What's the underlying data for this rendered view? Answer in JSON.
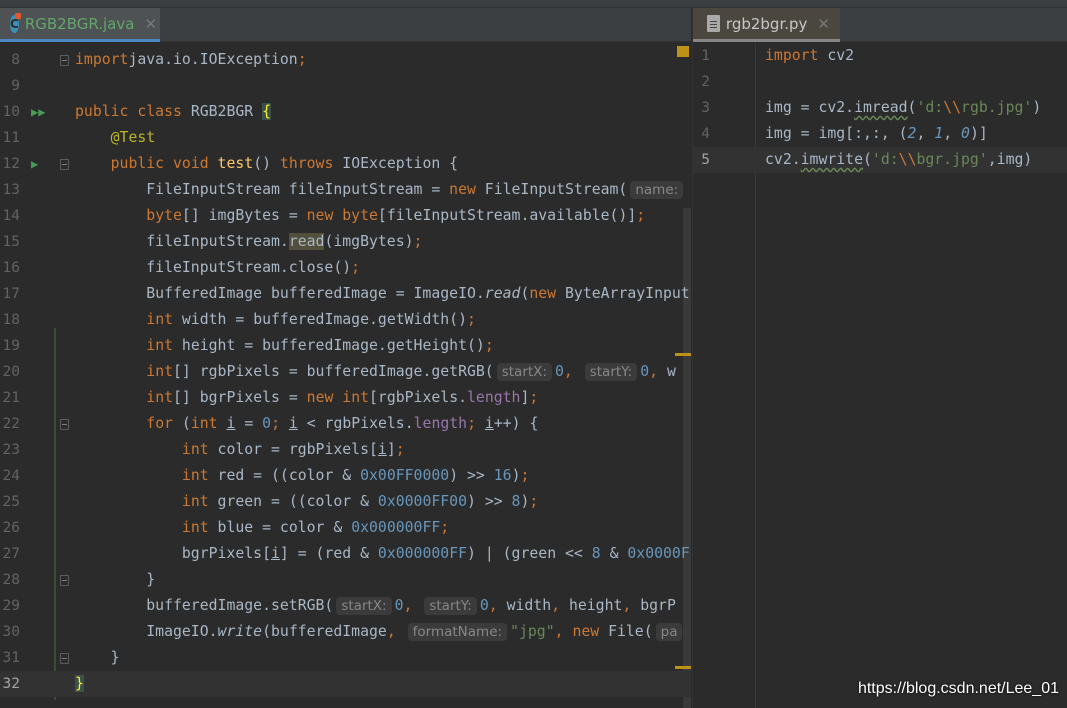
{
  "tabs": [
    {
      "label": "RGB2BGR.java",
      "icon": "java-class-icon",
      "close_glyph": "✕",
      "active": true
    },
    {
      "label": "rgb2bgr.py",
      "icon": "python-file-icon",
      "close_glyph": "✕",
      "active": true
    }
  ],
  "colors": {
    "keyword": "#cc7832",
    "number": "#6897bb",
    "string": "#6a8759",
    "field": "#9876aa",
    "annotation": "#bbb529",
    "method_decl": "#ffc66d",
    "text": "#a9b7c6",
    "background": "#2b2b2b"
  },
  "java": {
    "current_line": "32",
    "lines": [
      {
        "n": "8",
        "fold": true,
        "t": [
          [
            "kw",
            "import"
          ],
          [
            "",
            "java.io.IOException"
          ],
          [
            "kw",
            ";"
          ]
        ]
      },
      {
        "n": "9",
        "t": []
      },
      {
        "n": "10",
        "run": "▶▶",
        "t": [
          [
            "kw",
            "public class "
          ],
          [
            "",
            "RGB2BGR "
          ],
          [
            "brace",
            "{"
          ]
        ]
      },
      {
        "n": "11",
        "t": [
          [
            "",
            "    "
          ],
          [
            "ann",
            "@Test"
          ]
        ]
      },
      {
        "n": "12",
        "run": "▶",
        "fold": true,
        "t": [
          [
            "",
            "    "
          ],
          [
            "kw",
            "public void "
          ],
          [
            "fn",
            "test"
          ],
          [
            "",
            "() "
          ],
          [
            "kw",
            "throws "
          ],
          [
            "",
            "IOException {"
          ]
        ]
      },
      {
        "n": "13",
        "t": [
          [
            "",
            "        FileInputStream fileInputStream = "
          ],
          [
            "kw",
            "new "
          ],
          [
            "",
            "FileInputStream("
          ],
          [
            "hint",
            "name:"
          ]
        ]
      },
      {
        "n": "14",
        "t": [
          [
            "",
            "        "
          ],
          [
            "kw",
            "byte"
          ],
          [
            "",
            "[] imgBytes = "
          ],
          [
            "kw",
            "new byte"
          ],
          [
            "",
            "[fileInputStream.available()]"
          ],
          [
            "kw",
            ";"
          ]
        ]
      },
      {
        "n": "15",
        "t": [
          [
            "",
            "        fileInputStream."
          ],
          [
            "hl",
            "read"
          ],
          [
            "",
            "(imgBytes)"
          ],
          [
            "kw",
            ";"
          ]
        ]
      },
      {
        "n": "16",
        "t": [
          [
            "",
            "        fileInputStream.close()"
          ],
          [
            "kw",
            ";"
          ]
        ]
      },
      {
        "n": "17",
        "t": [
          [
            "",
            "        BufferedImage bufferedImage = ImageIO."
          ],
          [
            "it",
            "read"
          ],
          [
            "",
            "("
          ],
          [
            "kw",
            "new "
          ],
          [
            "",
            "ByteArrayInput"
          ]
        ]
      },
      {
        "n": "18",
        "t": [
          [
            "",
            "        "
          ],
          [
            "kw",
            "int "
          ],
          [
            "",
            "width = bufferedImage.getWidth()"
          ],
          [
            "kw",
            ";"
          ]
        ]
      },
      {
        "n": "19",
        "t": [
          [
            "",
            "        "
          ],
          [
            "kw",
            "int "
          ],
          [
            "",
            "height = bufferedImage.getHeight()"
          ],
          [
            "kw",
            ";"
          ]
        ]
      },
      {
        "n": "20",
        "t": [
          [
            "",
            "        "
          ],
          [
            "kw",
            "int"
          ],
          [
            "",
            "[] rgbPixels = bufferedImage.getRGB("
          ],
          [
            "hint",
            "startX:"
          ],
          [
            "num",
            "0"
          ],
          [
            "kw",
            ", "
          ],
          [
            "hint",
            "startY:"
          ],
          [
            "num",
            "0"
          ],
          [
            "kw",
            ", "
          ],
          [
            "",
            "w"
          ]
        ]
      },
      {
        "n": "21",
        "t": [
          [
            "",
            "        "
          ],
          [
            "kw",
            "int"
          ],
          [
            "",
            "[] bgrPixels = "
          ],
          [
            "kw",
            "new int"
          ],
          [
            "",
            "[rgbPixels."
          ],
          [
            "field",
            "length"
          ],
          [
            "",
            "]"
          ],
          [
            "kw",
            ";"
          ]
        ]
      },
      {
        "n": "22",
        "fold": true,
        "t": [
          [
            "",
            "        "
          ],
          [
            "kw",
            "for "
          ],
          [
            "",
            "("
          ],
          [
            "kw",
            "int "
          ],
          [
            "u",
            "i"
          ],
          [
            "",
            " = "
          ],
          [
            "num",
            "0"
          ],
          [
            "kw",
            "; "
          ],
          [
            "u",
            "i"
          ],
          [
            "",
            " < rgbPixels."
          ],
          [
            "field",
            "length"
          ],
          [
            "kw",
            "; "
          ],
          [
            "u",
            "i"
          ],
          [
            "",
            "++) {"
          ]
        ]
      },
      {
        "n": "23",
        "t": [
          [
            "",
            "            "
          ],
          [
            "kw",
            "int "
          ],
          [
            "",
            "color = rgbPixels["
          ],
          [
            "u",
            "i"
          ],
          [
            "",
            "]"
          ],
          [
            "kw",
            ";"
          ]
        ]
      },
      {
        "n": "24",
        "t": [
          [
            "",
            "            "
          ],
          [
            "kw",
            "int "
          ],
          [
            "",
            "red = ((color & "
          ],
          [
            "num",
            "0x00FF0000"
          ],
          [
            "",
            ") >> "
          ],
          [
            "num",
            "16"
          ],
          [
            "",
            ")"
          ],
          [
            "kw",
            ";"
          ]
        ]
      },
      {
        "n": "25",
        "t": [
          [
            "",
            "            "
          ],
          [
            "kw",
            "int "
          ],
          [
            "",
            "green = ((color & "
          ],
          [
            "num",
            "0x0000FF00"
          ],
          [
            "",
            ") >> "
          ],
          [
            "num",
            "8"
          ],
          [
            "",
            ")"
          ],
          [
            "kw",
            ";"
          ]
        ]
      },
      {
        "n": "26",
        "t": [
          [
            "",
            "            "
          ],
          [
            "kw",
            "int "
          ],
          [
            "",
            "blue = color & "
          ],
          [
            "num",
            "0x000000FF"
          ],
          [
            "kw",
            ";"
          ]
        ]
      },
      {
        "n": "27",
        "t": [
          [
            "",
            "            bgrPixels["
          ],
          [
            "u",
            "i"
          ],
          [
            "",
            "] = (red & "
          ],
          [
            "num",
            "0x000000FF"
          ],
          [
            "",
            ") | (green << "
          ],
          [
            "num",
            "8"
          ],
          [
            "",
            " & "
          ],
          [
            "num",
            "0x0000F"
          ]
        ]
      },
      {
        "n": "28",
        "fold": true,
        "t": [
          [
            "",
            "        }"
          ]
        ]
      },
      {
        "n": "29",
        "t": [
          [
            "",
            "        bufferedImage.setRGB("
          ],
          [
            "hint",
            "startX:"
          ],
          [
            "num",
            "0"
          ],
          [
            "kw",
            ", "
          ],
          [
            "hint",
            "startY:"
          ],
          [
            "num",
            "0"
          ],
          [
            "kw",
            ", "
          ],
          [
            "",
            "width"
          ],
          [
            "kw",
            ", "
          ],
          [
            "",
            "height"
          ],
          [
            "kw",
            ", "
          ],
          [
            "",
            "bgrP"
          ]
        ]
      },
      {
        "n": "30",
        "t": [
          [
            "",
            "        ImageIO."
          ],
          [
            "it",
            "write"
          ],
          [
            "",
            "(bufferedImage"
          ],
          [
            "kw",
            ", "
          ],
          [
            "hint",
            "formatName:"
          ],
          [
            "str",
            "\"jpg\""
          ],
          [
            "kw",
            ", "
          ],
          [
            "kw",
            "new "
          ],
          [
            "",
            "File("
          ],
          [
            "hint",
            "pa"
          ]
        ]
      },
      {
        "n": "31",
        "fold": true,
        "t": [
          [
            "",
            "    }"
          ]
        ]
      },
      {
        "n": "32",
        "t": [
          [
            "brace",
            "}"
          ]
        ]
      }
    ]
  },
  "python": {
    "current_line": "5",
    "lines": [
      {
        "n": "1",
        "t": [
          [
            "kw",
            "import "
          ],
          [
            "",
            "cv2"
          ]
        ]
      },
      {
        "n": "2",
        "t": []
      },
      {
        "n": "3",
        "t": [
          [
            "",
            "img = cv2."
          ],
          [
            "warn",
            "imread"
          ],
          [
            "",
            "("
          ],
          [
            "str",
            "'d:"
          ],
          [
            "esc",
            "\\\\"
          ],
          [
            "str",
            "rgb.jpg'"
          ],
          [
            "",
            ")"
          ]
        ]
      },
      {
        "n": "4",
        "t": [
          [
            "",
            "img = img[:,:, ("
          ],
          [
            "numit",
            "2"
          ],
          [
            "",
            ", "
          ],
          [
            "numit",
            "1"
          ],
          [
            "",
            ", "
          ],
          [
            "numit",
            "0"
          ],
          [
            "",
            ")]"
          ]
        ]
      },
      {
        "n": "5",
        "t": [
          [
            "",
            "cv2."
          ],
          [
            "warn",
            "imwrite"
          ],
          [
            "",
            "("
          ],
          [
            "str",
            "'d:"
          ],
          [
            "esc",
            "\\\\"
          ],
          [
            "str",
            "bgr.jpg'"
          ],
          [
            "",
            ",img)"
          ]
        ]
      }
    ]
  },
  "watermark": "https://blog.csdn.net/Lee_01"
}
